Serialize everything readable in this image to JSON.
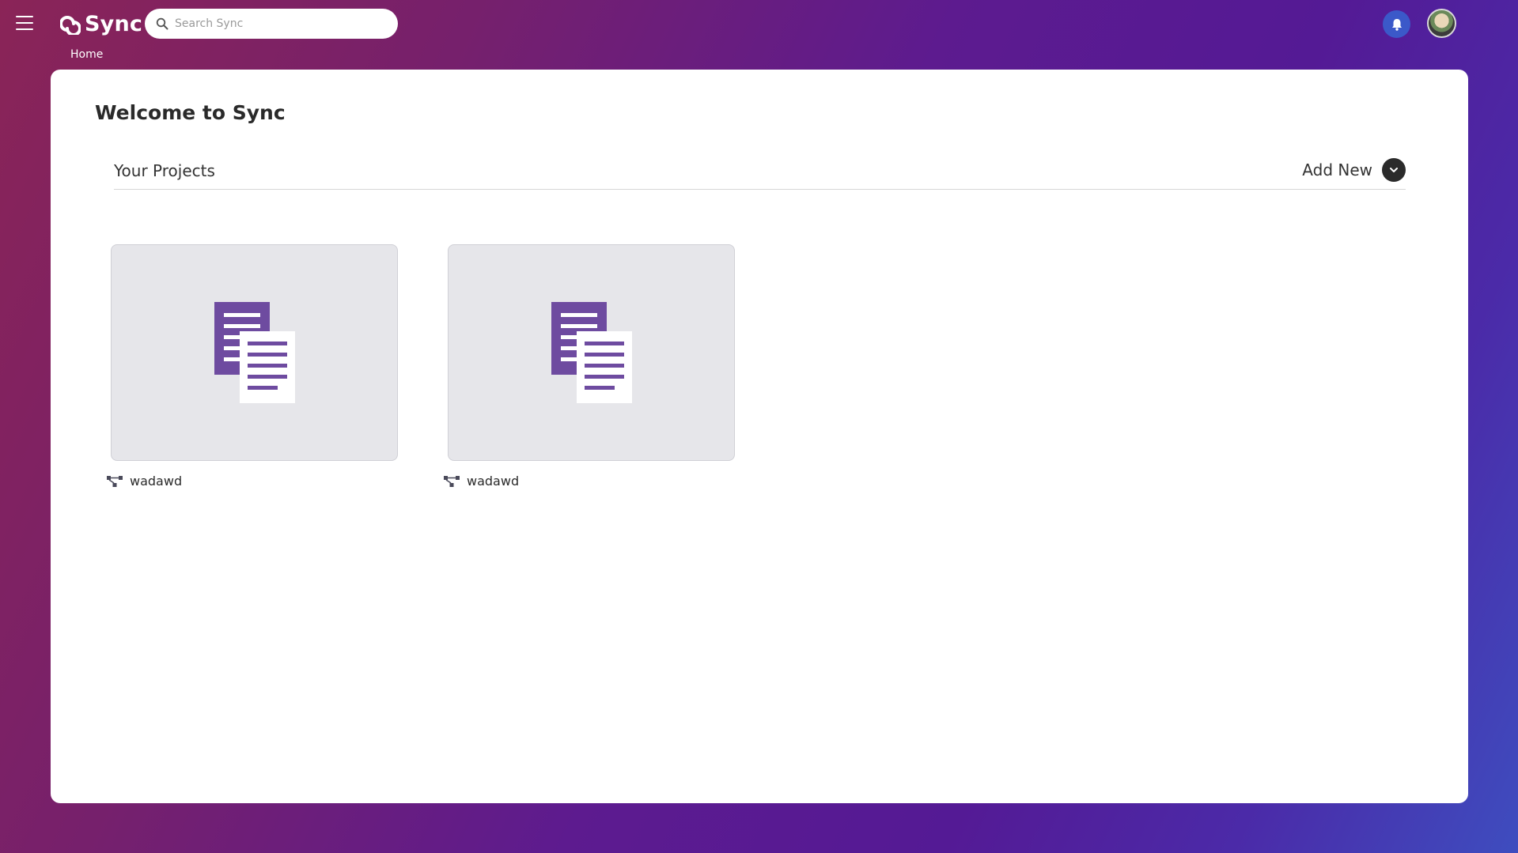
{
  "app": {
    "name": "Sync"
  },
  "icons": {
    "menu": "hamburger-menu-icon",
    "logo": "sync-logo-icon",
    "search": "search-icon",
    "notifications": "bell-icon",
    "add": "chevron-down-icon",
    "project_thumb": "documents-icon",
    "project_type": "workflow-icon"
  },
  "colors": {
    "accent": "#6e4ba0",
    "bell_bg": "#3b59c9",
    "card_bg": "#e6e6ea"
  },
  "header": {
    "search_placeholder": "Search Sync",
    "breadcrumb": "Home"
  },
  "main": {
    "title": "Welcome to Sync",
    "section_title": "Your Projects",
    "add_new_label": "Add New",
    "projects": [
      {
        "name": "wadawd"
      },
      {
        "name": "wadawd"
      }
    ]
  }
}
